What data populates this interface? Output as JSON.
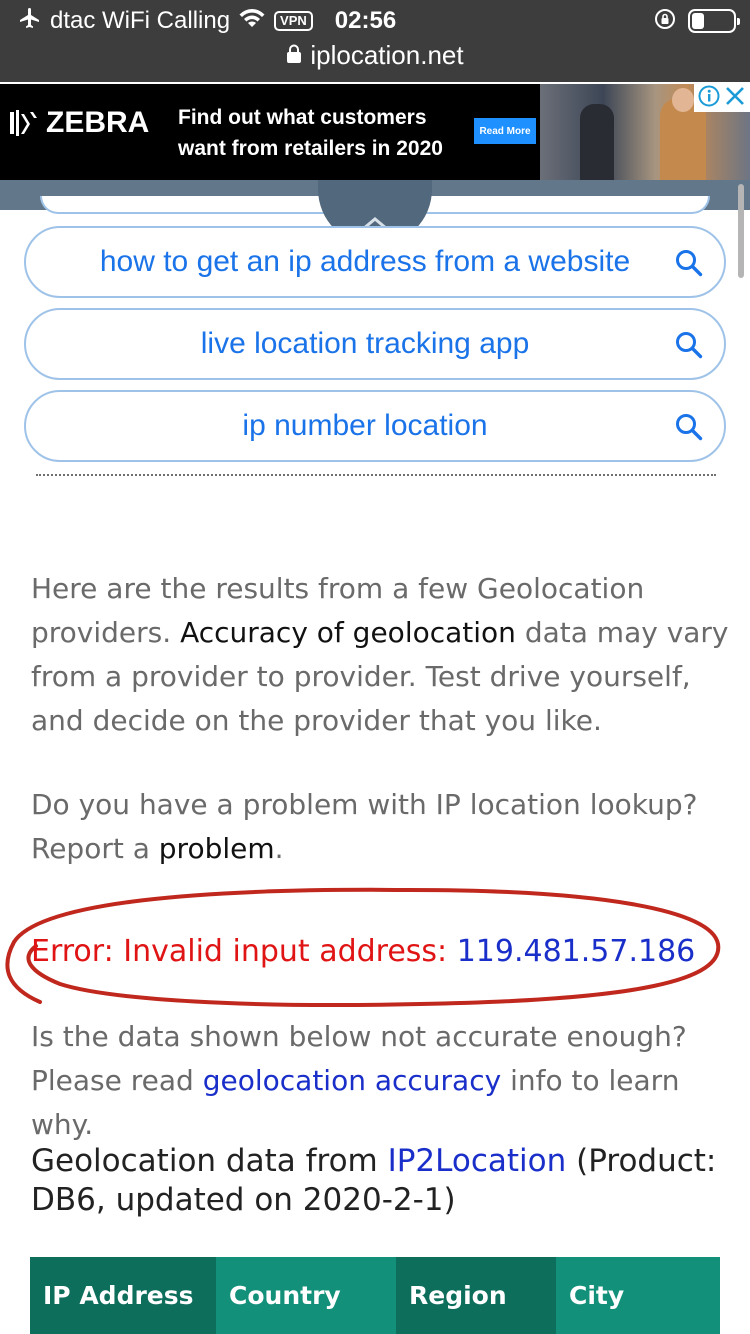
{
  "status_bar": {
    "carrier": "dtac WiFi Calling",
    "vpn": "VPN",
    "time": "02:56",
    "url": "iplocation.net",
    "battery_level": 0.3
  },
  "ad": {
    "brand": "ZEBRA",
    "headline_line1": "Find out what customers",
    "headline_line2": "want from retailers in 2020",
    "cta": "Read More"
  },
  "suggestions": [
    {
      "label": "how to get an ip address from a website"
    },
    {
      "label": "live location tracking app"
    },
    {
      "label": "ip number location"
    }
  ],
  "intro": {
    "part1": "Here are the results from a few Geolocation providers. ",
    "link": "Accuracy of geolocation",
    "part2": " data may vary from a provider to provider. Test drive yourself, and decide on the provider that you like."
  },
  "report": {
    "part1": "Do you have a problem with IP location lookup? Report a ",
    "link": "problem",
    "part2": "."
  },
  "error": {
    "label": "Error: Invalid input address: ",
    "value": "119.481.57.186"
  },
  "accuracy_note": {
    "part1": "Is the data shown below not accurate enough? Please read ",
    "link": "geolocation accuracy",
    "part2": " info to learn why."
  },
  "provider_heading": {
    "part1": "Geolocation data from ",
    "link": "IP2Location",
    "part2": " (Product: DB6, updated on 2020-2-1)"
  },
  "table": {
    "headers": [
      "IP Address",
      "Country",
      "Region",
      "City"
    ],
    "colors": {
      "dark": "#0e6e5c",
      "light": "#13907a"
    }
  },
  "colors": {
    "link_blue": "#1a73e8",
    "error_red": "#e01414",
    "annotation_red": "#c0281e"
  }
}
